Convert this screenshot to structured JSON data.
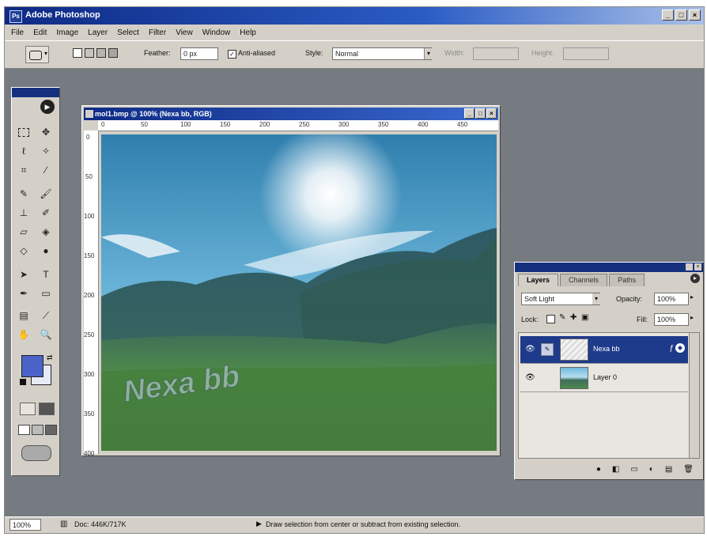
{
  "app": {
    "title": "Adobe Photoshop"
  },
  "menu": [
    "File",
    "Edit",
    "Image",
    "Layer",
    "Select",
    "Filter",
    "View",
    "Window",
    "Help"
  ],
  "options": {
    "feather_label": "Feather:",
    "feather_value": "0 px",
    "antialiased_label": "Anti-aliased",
    "style_label": "Style:",
    "style_value": "Normal",
    "width_label": "Width:",
    "height_label": "Height:"
  },
  "document": {
    "title": "mol1.bmp @ 100% (Nexa bb, RGB)",
    "ruler_h": [
      "0",
      "50",
      "100",
      "150",
      "200",
      "250",
      "300",
      "350",
      "400",
      "450"
    ],
    "ruler_v": [
      "0",
      "50",
      "100",
      "150",
      "200",
      "250",
      "300",
      "350",
      "400"
    ],
    "canvas_text": "Nexa bb"
  },
  "layers_panel": {
    "tabs": [
      "Layers",
      "Channels",
      "Paths"
    ],
    "active_tab": "Layers",
    "blend_mode": "Soft Light",
    "opacity_label": "Opacity:",
    "opacity_value": "100%",
    "lock_label": "Lock:",
    "fill_label": "Fill:",
    "fill_value": "100%",
    "layers": [
      {
        "name": "Nexa bb",
        "selected": true
      },
      {
        "name": "Layer 0",
        "selected": false
      }
    ]
  },
  "status": {
    "zoom": "100%",
    "doc": "Doc: 446K/717K",
    "message": "Draw selection from center or subtract from existing selection."
  },
  "colors": {
    "foreground": "#4a63c9",
    "background": "#e6ebf6"
  }
}
